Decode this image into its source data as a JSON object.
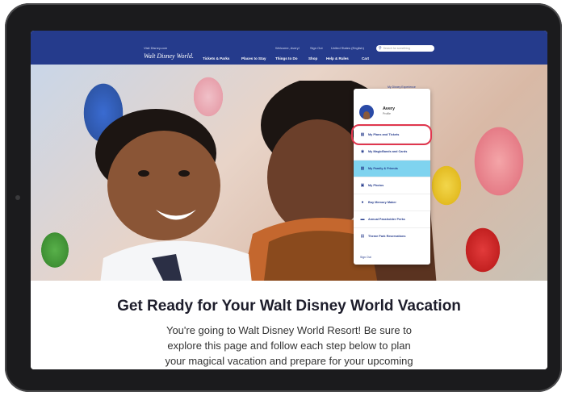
{
  "header": {
    "top_left_text": "Visit Disney.com",
    "welcome_text": "Welcome, Avery!",
    "sign_out_text": "Sign Out",
    "region_text": "United States (English)",
    "search_placeholder": "Search for something",
    "logo_text": "Walt Disney World."
  },
  "nav": {
    "items": [
      "Tickets & Parks",
      "Places to Stay",
      "Things to Do",
      "Shop",
      "Help & Rules",
      "Cart",
      "My Disney Experience"
    ]
  },
  "dropdown": {
    "user_name": "Avery",
    "user_sub": "Profile",
    "items": [
      {
        "label": "My Plans and Tickets",
        "icon": "calendar-icon"
      },
      {
        "label": "My MagicBands and Cards",
        "icon": "magicband-icon"
      },
      {
        "label": "My Family & Friends",
        "icon": "family-icon"
      },
      {
        "label": "My Photos",
        "icon": "camera-icon"
      },
      {
        "label": "Buy Memory Maker",
        "icon": "memory-icon"
      },
      {
        "label": "Annual Passholder Perks",
        "icon": "ticket-icon"
      },
      {
        "label": "Theme Park Reservations",
        "icon": "park-icon"
      }
    ],
    "sign_out": "Sign Out",
    "highlighted_color": "#e0364e"
  },
  "content": {
    "heading": "Get Ready for Your Walt Disney World Vacation",
    "body": "You're going to Walt Disney World Resort! Be sure to explore this page and follow each step below to plan your magical vacation and prepare for your upcoming visit!"
  }
}
